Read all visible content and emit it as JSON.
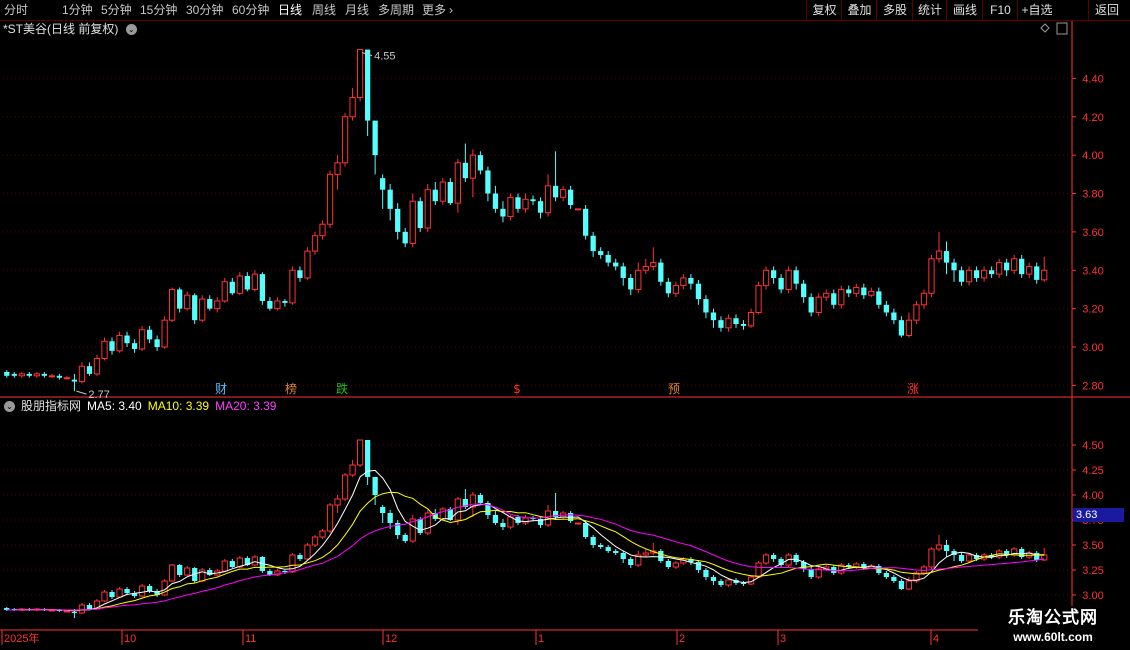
{
  "toolbar": {
    "timeframes": [
      "分时",
      "1分钟",
      "5分钟",
      "15分钟",
      "30分钟",
      "60分钟",
      "日线",
      "周线",
      "月线",
      "多周期",
      "更多"
    ],
    "active": "日线",
    "more_chevron": "›",
    "buttons": [
      "复权",
      "叠加",
      "多股",
      "统计",
      "画线",
      "F10",
      "+自选",
      "返回"
    ]
  },
  "title": {
    "text": "*ST美谷(日线 前复权)",
    "chevron": "⌄"
  },
  "legend": {
    "indicator": "股朋指标网",
    "ma5": "MA5: 3.40",
    "ma10": "MA10: 3.39",
    "ma20": "MA20: 3.39"
  },
  "current_value": "3.63",
  "markers": [
    {
      "text": "财",
      "color": "#5bbfff",
      "x": 221
    },
    {
      "text": "榜",
      "color": "#e08030",
      "x": 291
    },
    {
      "text": "跌",
      "color": "#20c020",
      "x": 342
    },
    {
      "text": "$",
      "color": "#ff3030",
      "x": 517
    },
    {
      "text": "预",
      "color": "#e08030",
      "x": 674
    },
    {
      "text": "涨",
      "color": "#ff3030",
      "x": 913
    }
  ],
  "annotations": {
    "high": "4.55",
    "low": "2.77"
  },
  "watermark": {
    "line1": "乐淘公式网",
    "line2": "www.60lt.com"
  },
  "colors": {
    "up": "#ff3232",
    "down": "#54ffff",
    "ma5": "#ffffff",
    "ma10": "#ffff00",
    "ma20": "#ff00ff",
    "grid": "#5a0000",
    "axis": "#ff3232"
  },
  "chart_data": [
    {
      "type": "candlestick",
      "name": "main",
      "y_ticks": [
        "4.40",
        "4.20",
        "4.00",
        "3.80",
        "3.60",
        "3.40",
        "3.20",
        "3.00",
        "2.80"
      ],
      "ylim": [
        2.75,
        4.6
      ],
      "points": [
        [
          2.87,
          2.85,
          2.88,
          2.84
        ],
        [
          2.86,
          2.85,
          2.87,
          2.84
        ],
        [
          2.85,
          2.86,
          2.87,
          2.84
        ],
        [
          2.86,
          2.85,
          2.87,
          2.84
        ],
        [
          2.85,
          2.86,
          2.87,
          2.84
        ],
        [
          2.86,
          2.85,
          2.87,
          2.84
        ],
        [
          2.85,
          2.85,
          2.86,
          2.84
        ],
        [
          2.85,
          2.84,
          2.86,
          2.83
        ],
        [
          2.84,
          2.84,
          2.85,
          2.83
        ],
        [
          2.83,
          2.82,
          2.86,
          2.77
        ],
        [
          2.82,
          2.9,
          2.92,
          2.81
        ],
        [
          2.9,
          2.86,
          2.92,
          2.85
        ],
        [
          2.86,
          2.94,
          2.96,
          2.85
        ],
        [
          2.94,
          3.03,
          3.05,
          2.93
        ],
        [
          3.03,
          2.98,
          3.05,
          2.96
        ],
        [
          2.98,
          3.06,
          3.08,
          2.97
        ],
        [
          3.06,
          3.02,
          3.08,
          3.0
        ],
        [
          3.02,
          2.99,
          3.04,
          2.97
        ],
        [
          2.99,
          3.09,
          3.11,
          2.98
        ],
        [
          3.09,
          3.04,
          3.11,
          3.02
        ],
        [
          3.04,
          3.0,
          3.06,
          2.98
        ],
        [
          3.0,
          3.14,
          3.16,
          2.99
        ],
        [
          3.14,
          3.3,
          3.31,
          3.13
        ],
        [
          3.3,
          3.2,
          3.31,
          3.18
        ],
        [
          3.2,
          3.27,
          3.29,
          3.19
        ],
        [
          3.27,
          3.14,
          3.28,
          3.12
        ],
        [
          3.14,
          3.25,
          3.27,
          3.13
        ],
        [
          3.25,
          3.2,
          3.27,
          3.19
        ],
        [
          3.2,
          3.24,
          3.26,
          3.18
        ],
        [
          3.24,
          3.34,
          3.36,
          3.23
        ],
        [
          3.34,
          3.28,
          3.36,
          3.27
        ],
        [
          3.28,
          3.37,
          3.39,
          3.27
        ],
        [
          3.37,
          3.3,
          3.39,
          3.29
        ],
        [
          3.3,
          3.38,
          3.4,
          3.29
        ],
        [
          3.38,
          3.24,
          3.39,
          3.22
        ],
        [
          3.24,
          3.2,
          3.26,
          3.19
        ],
        [
          3.2,
          3.24,
          3.26,
          3.19
        ],
        [
          3.24,
          3.23,
          3.25,
          3.21
        ],
        [
          3.23,
          3.4,
          3.42,
          3.22
        ],
        [
          3.4,
          3.36,
          3.42,
          3.34
        ],
        [
          3.36,
          3.5,
          3.52,
          3.35
        ],
        [
          3.5,
          3.58,
          3.6,
          3.48
        ],
        [
          3.58,
          3.64,
          3.66,
          3.56
        ],
        [
          3.64,
          3.9,
          3.92,
          3.62
        ],
        [
          3.9,
          3.96,
          4.0,
          3.82
        ],
        [
          3.96,
          4.2,
          4.22,
          3.94
        ],
        [
          4.2,
          4.3,
          4.35,
          4.18
        ],
        [
          4.3,
          4.55,
          4.55,
          4.28
        ],
        [
          4.55,
          4.18,
          4.55,
          4.1
        ],
        [
          4.18,
          4.0,
          4.1,
          3.9
        ],
        [
          3.88,
          3.82,
          3.9,
          3.72
        ],
        [
          3.82,
          3.72,
          3.85,
          3.66
        ],
        [
          3.72,
          3.6,
          3.75,
          3.56
        ],
        [
          3.6,
          3.54,
          3.62,
          3.52
        ],
        [
          3.54,
          3.76,
          3.8,
          3.52
        ],
        [
          3.76,
          3.62,
          3.78,
          3.6
        ],
        [
          3.62,
          3.82,
          3.85,
          3.6
        ],
        [
          3.82,
          3.76,
          3.86,
          3.74
        ],
        [
          3.76,
          3.86,
          3.88,
          3.74
        ],
        [
          3.86,
          3.75,
          3.88,
          3.74
        ],
        [
          3.75,
          3.96,
          3.98,
          3.7
        ],
        [
          3.96,
          3.88,
          4.06,
          3.86
        ],
        [
          3.88,
          4.0,
          4.03,
          3.78
        ],
        [
          4.0,
          3.92,
          4.02,
          3.9
        ],
        [
          3.92,
          3.8,
          3.94,
          3.76
        ],
        [
          3.8,
          3.72,
          3.84,
          3.7
        ],
        [
          3.72,
          3.68,
          3.76,
          3.65
        ],
        [
          3.68,
          3.78,
          3.8,
          3.66
        ],
        [
          3.78,
          3.72,
          3.8,
          3.7
        ],
        [
          3.72,
          3.77,
          3.8,
          3.7
        ],
        [
          3.77,
          3.76,
          3.79,
          3.74
        ],
        [
          3.76,
          3.7,
          3.78,
          3.67
        ],
        [
          3.7,
          3.84,
          3.9,
          3.68
        ],
        [
          3.84,
          3.78,
          4.02,
          3.76
        ],
        [
          3.78,
          3.82,
          3.84,
          3.76
        ],
        [
          3.82,
          3.74,
          3.84,
          3.72
        ],
        [
          3.72,
          3.72,
          3.72,
          3.72
        ],
        [
          3.72,
          3.58,
          3.74,
          3.56
        ],
        [
          3.58,
          3.5,
          3.6,
          3.47
        ],
        [
          3.5,
          3.48,
          3.52,
          3.46
        ],
        [
          3.48,
          3.44,
          3.5,
          3.42
        ],
        [
          3.44,
          3.42,
          3.46,
          3.4
        ],
        [
          3.42,
          3.36,
          3.44,
          3.32
        ],
        [
          3.36,
          3.3,
          3.38,
          3.27
        ],
        [
          3.3,
          3.4,
          3.44,
          3.28
        ],
        [
          3.4,
          3.42,
          3.46,
          3.38
        ],
        [
          3.42,
          3.44,
          3.52,
          3.4
        ],
        [
          3.44,
          3.34,
          3.46,
          3.32
        ],
        [
          3.34,
          3.28,
          3.36,
          3.26
        ],
        [
          3.28,
          3.32,
          3.34,
          3.26
        ],
        [
          3.32,
          3.36,
          3.38,
          3.3
        ],
        [
          3.36,
          3.33,
          3.38,
          3.3
        ],
        [
          3.33,
          3.25,
          3.35,
          3.22
        ],
        [
          3.25,
          3.18,
          3.27,
          3.15
        ],
        [
          3.18,
          3.14,
          3.2,
          3.1
        ],
        [
          3.14,
          3.1,
          3.16,
          3.08
        ],
        [
          3.1,
          3.15,
          3.17,
          3.08
        ],
        [
          3.15,
          3.12,
          3.17,
          3.1
        ],
        [
          3.12,
          3.11,
          3.14,
          3.09
        ],
        [
          3.11,
          3.18,
          3.2,
          3.1
        ],
        [
          3.18,
          3.32,
          3.34,
          3.17
        ],
        [
          3.32,
          3.4,
          3.42,
          3.3
        ],
        [
          3.4,
          3.36,
          3.42,
          3.33
        ],
        [
          3.36,
          3.3,
          3.38,
          3.28
        ],
        [
          3.3,
          3.4,
          3.42,
          3.28
        ],
        [
          3.4,
          3.33,
          3.42,
          3.3
        ],
        [
          3.33,
          3.26,
          3.35,
          3.23
        ],
        [
          3.26,
          3.18,
          3.28,
          3.16
        ],
        [
          3.18,
          3.26,
          3.28,
          3.16
        ],
        [
          3.26,
          3.28,
          3.3,
          3.24
        ],
        [
          3.28,
          3.22,
          3.3,
          3.2
        ],
        [
          3.22,
          3.3,
          3.32,
          3.2
        ],
        [
          3.3,
          3.28,
          3.32,
          3.26
        ],
        [
          3.28,
          3.31,
          3.33,
          3.26
        ],
        [
          3.31,
          3.27,
          3.33,
          3.25
        ],
        [
          3.27,
          3.29,
          3.31,
          3.26
        ],
        [
          3.29,
          3.22,
          3.31,
          3.2
        ],
        [
          3.22,
          3.18,
          3.24,
          3.16
        ],
        [
          3.18,
          3.14,
          3.2,
          3.12
        ],
        [
          3.14,
          3.06,
          3.16,
          3.05
        ],
        [
          3.06,
          3.14,
          3.18,
          3.05
        ],
        [
          3.14,
          3.22,
          3.24,
          3.12
        ],
        [
          3.22,
          3.28,
          3.3,
          3.2
        ],
        [
          3.28,
          3.46,
          3.48,
          3.26
        ],
        [
          3.46,
          3.5,
          3.6,
          3.44
        ],
        [
          3.5,
          3.44,
          3.55,
          3.38
        ],
        [
          3.44,
          3.4,
          3.46,
          3.34
        ],
        [
          3.4,
          3.34,
          3.42,
          3.32
        ],
        [
          3.34,
          3.4,
          3.42,
          3.32
        ],
        [
          3.4,
          3.36,
          3.42,
          3.34
        ],
        [
          3.36,
          3.4,
          3.42,
          3.34
        ],
        [
          3.4,
          3.38,
          3.42,
          3.36
        ],
        [
          3.38,
          3.44,
          3.46,
          3.36
        ],
        [
          3.44,
          3.4,
          3.46,
          3.37
        ],
        [
          3.4,
          3.46,
          3.48,
          3.38
        ],
        [
          3.46,
          3.38,
          3.48,
          3.36
        ],
        [
          3.38,
          3.42,
          3.44,
          3.36
        ],
        [
          3.42,
          3.35,
          3.44,
          3.33
        ],
        [
          3.35,
          3.4,
          3.47,
          3.34
        ]
      ]
    },
    {
      "type": "candlestick",
      "name": "indicator",
      "y_ticks": [
        "4.50",
        "4.25",
        "4.00",
        "3.75",
        "3.50",
        "3.25",
        "3.00"
      ],
      "ylim": [
        2.9,
        4.75
      ],
      "series": [
        {
          "name": "MA5",
          "value": "3.40"
        },
        {
          "name": "MA10",
          "value": "3.39"
        },
        {
          "name": "MA20",
          "value": "3.39"
        }
      ]
    }
  ],
  "x_labels": [
    {
      "text": "2025年",
      "x": 4
    },
    {
      "text": "10",
      "x": 124
    },
    {
      "text": "11",
      "x": 245
    },
    {
      "text": "12",
      "x": 385
    },
    {
      "text": "1",
      "x": 538
    },
    {
      "text": "2",
      "x": 679
    },
    {
      "text": "3",
      "x": 780
    },
    {
      "text": "4",
      "x": 933
    }
  ]
}
